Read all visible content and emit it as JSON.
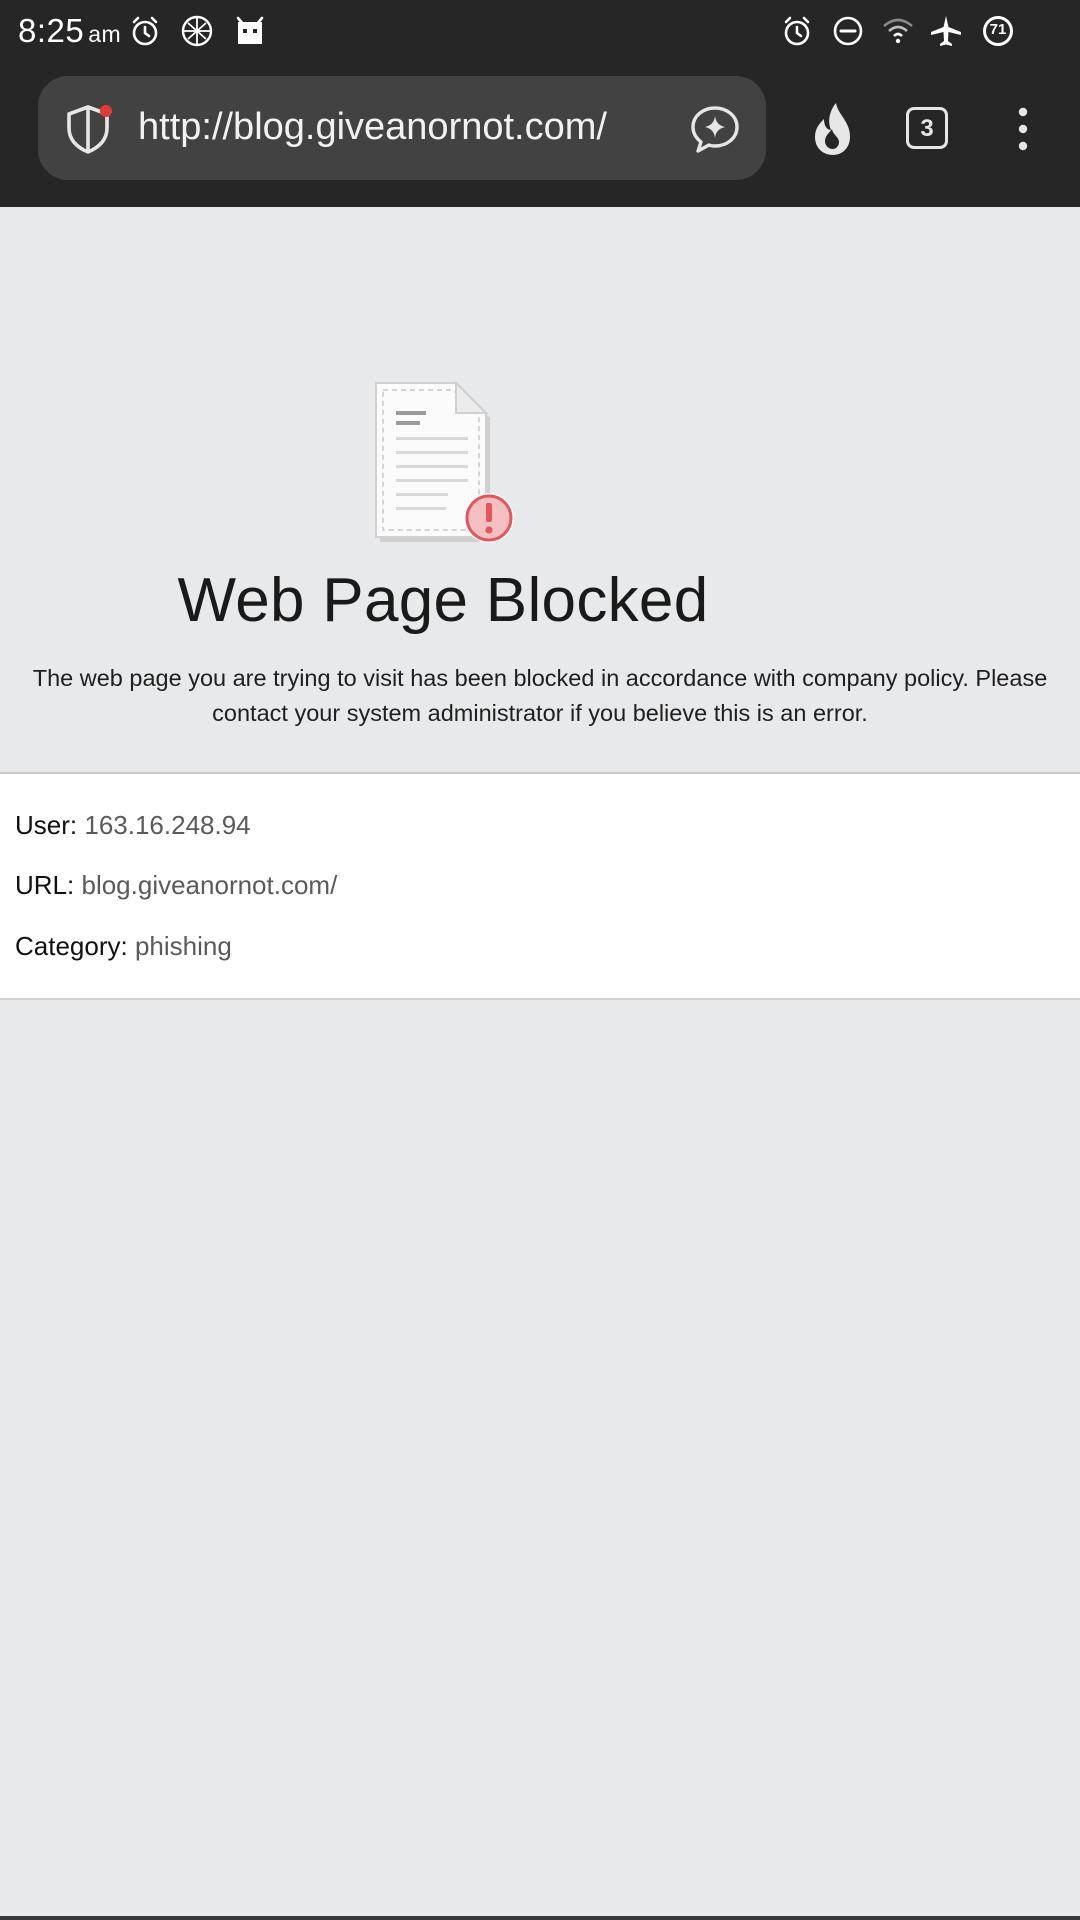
{
  "status_bar": {
    "time": "8:25",
    "ampm": "am",
    "battery_level": "71",
    "icons_left": [
      "alarm-icon",
      "brain-app-icon",
      "android-app-icon"
    ],
    "icons_right": [
      "alarm-icon",
      "do-not-disturb-icon",
      "wifi-icon",
      "airplane-mode-icon",
      "battery-icon"
    ]
  },
  "browser": {
    "url": "http://blog.giveanornot.com/",
    "tab_count": "3",
    "icons": [
      "shield-icon",
      "ai-sparkle-chat-icon",
      "flame-icon",
      "tabs-icon",
      "more-vert-icon"
    ]
  },
  "blocked_page": {
    "title": "Web Page Blocked",
    "message": "The web page you are trying to visit has been blocked in accordance with company policy. Please contact your system administrator if you believe this is an error.",
    "illustration": "blocked-document-icon"
  },
  "details": {
    "user_label": "User:",
    "user_value": "163.16.248.94",
    "url_label": "URL:",
    "url_value": "blog.giveanornot.com/",
    "category_label": "Category:",
    "category_value": "phishing"
  },
  "colors": {
    "chrome_bg": "#262626",
    "url_bar_bg": "#424242",
    "page_bg": "#e8e9ea",
    "alert_red": "#e8545c"
  }
}
